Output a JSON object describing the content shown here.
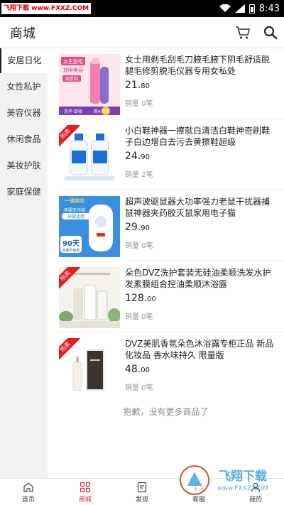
{
  "status_bar": {
    "site_badge": "飞翔下载 www.FXXZ.COM",
    "time": "8:43"
  },
  "header": {
    "title": "商城",
    "cart_icon": "cart-icon",
    "search_icon": "search-icon"
  },
  "sidebar": {
    "items": [
      {
        "label": "安居日化",
        "active": true
      },
      {
        "label": "女性私护",
        "active": false
      },
      {
        "label": "美容仪器",
        "active": false
      },
      {
        "label": "休闲食品",
        "active": false
      },
      {
        "label": "美妆护肤",
        "active": false
      },
      {
        "label": "家庭保健",
        "active": false
      }
    ]
  },
  "products": [
    {
      "title": "女士用剃毛刮毛刀腋毛腋下阴毛舒适脱腿毛修剪脱毛仪器专用女私处",
      "price_int": "21.",
      "price_dec": "80",
      "sales": "销量 0笔",
      "hot": false,
      "thumb_texts": [
        "女生刮毛",
        "放眼美丽",
        "随意刮",
        "洗手·卸妆",
        "新4刀头"
      ]
    },
    {
      "title": "小白鞋神器一擦就白清洁白鞋神奇刷鞋子白边增白去污去黄擦鞋超级",
      "price_int": "24.",
      "price_dec": "90",
      "sales": "销量 2笔",
      "hot": true,
      "ribbon": "热卖",
      "thumb_texts": []
    },
    {
      "title": "超声波驱鼠器大功率强力老鼠干扰器捕鼠神器夹药胶灭鼠家用电子猫",
      "price_int": "29.",
      "price_dec": "90",
      "sales": "销量 0笔",
      "hot": false,
      "thumb_texts": [
        "一键换频",
        "孕婴无污染",
        "孕婴适用",
        "90天",
        "全新升级款"
      ]
    },
    {
      "title": "朵色DVZ洗护套装无硅油柔顺洗发水护发素膜组合控油柔顺沐浴露",
      "price_int": "128.",
      "price_dec": "00",
      "sales": "销量 0笔",
      "hot": true,
      "ribbon": "热卖",
      "thumb_texts": []
    },
    {
      "title": "DVZ美肌香氛朵色沐浴露专柜正品 新品化妆品 香水味持久 限量版",
      "price_int": "48.",
      "price_dec": "00",
      "sales": "销量 0笔",
      "hot": true,
      "ribbon": "热卖",
      "thumb_texts": []
    }
  ],
  "list_end": "抱歉，没有更多商品了",
  "bottom_nav": [
    {
      "label": "首页",
      "icon": "home-icon",
      "active": false
    },
    {
      "label": "商城",
      "icon": "grid-icon",
      "active": true
    },
    {
      "label": "发现",
      "icon": "discover-icon",
      "active": false
    },
    {
      "label": "客服",
      "icon": "service-icon",
      "active": false
    },
    {
      "label": "我的",
      "icon": "user-icon",
      "active": false
    }
  ],
  "watermark": {
    "brand": "飞翔下载",
    "url": "www.FXXZ.COM"
  },
  "colors": {
    "accent": "#e0252a",
    "sidebar_bg": "#f2f2f2"
  }
}
